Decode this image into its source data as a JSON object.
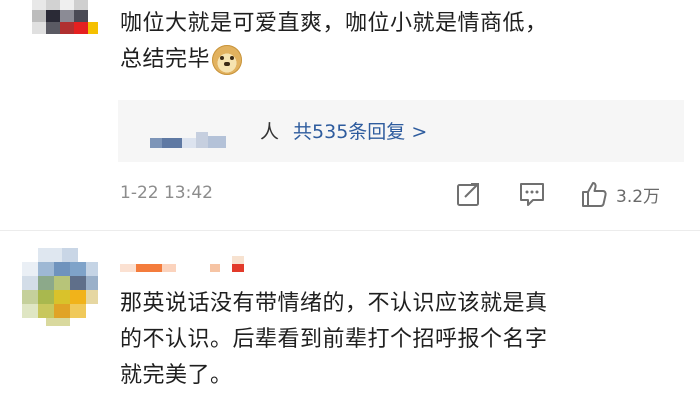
{
  "comments": [
    {
      "text_lines": [
        "咖位大就是可爱直爽，咖位小就是情商低，",
        "总结完毕"
      ],
      "emoji": "doge-emoji",
      "reply_summary": {
        "person_suffix": "人",
        "link_text": "共535条回复 >"
      },
      "time": "1-22 13:42",
      "like_count": "3.2万"
    },
    {
      "text_lines": [
        "那英说话没有带情绪的，不认识应该就是真",
        "的不认识。后辈看到前辈打个招呼报个名字",
        "就完美了。"
      ]
    }
  ],
  "icons": [
    "share-icon",
    "comment-icon",
    "like-icon"
  ],
  "colors": {
    "link": "#2e5c9e",
    "meta": "#8c8c8c",
    "reply_bg": "#f6f6f6"
  }
}
